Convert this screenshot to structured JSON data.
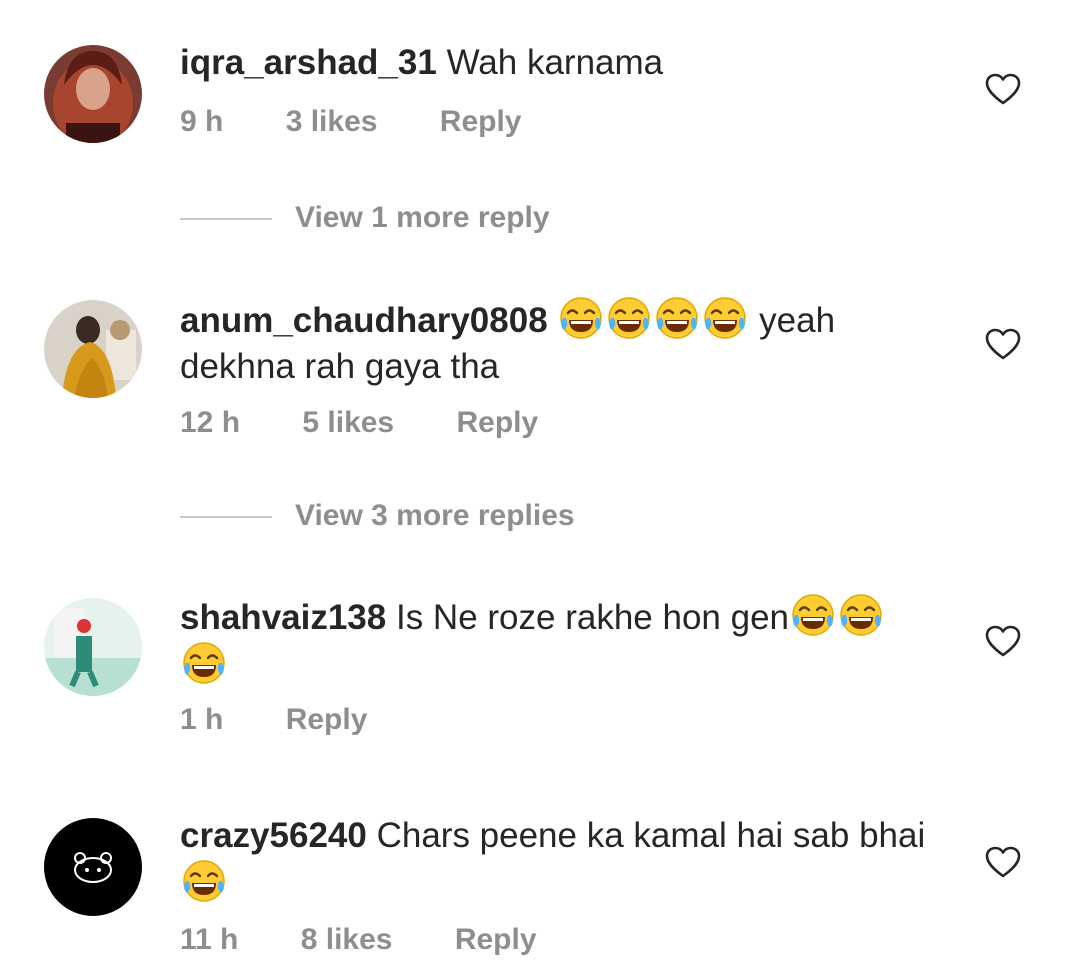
{
  "comments": [
    {
      "username": "iqra_arshad_31",
      "text_before": "Wah karnama",
      "text_after": "",
      "emoji_count": 0,
      "time": "9 h",
      "likes": "3 likes",
      "reply": "Reply",
      "view_replies": "View 1 more reply"
    },
    {
      "username": "anum_chaudhary0808",
      "text_before": "",
      "text_after": "yeah dekhna rah gaya tha",
      "emoji_count": 4,
      "time": "12 h",
      "likes": "5 likes",
      "reply": "Reply",
      "view_replies": "View 3 more replies"
    },
    {
      "username": "shahvaiz138",
      "text_before": "Is Ne roze rakhe hon gen",
      "text_after": "",
      "emoji_count": 3,
      "time": "1 h",
      "likes": "",
      "reply": "Reply",
      "view_replies": ""
    },
    {
      "username": "crazy56240",
      "text_before": "Chars peene ka kamal hai sab bhai",
      "text_after": "",
      "emoji_count": 1,
      "time": "11 h",
      "likes": "8 likes",
      "reply": "Reply",
      "view_replies": ""
    }
  ],
  "icons": {
    "like": "heart-outline-icon",
    "emoji": "face-with-tears-of-joy-emoji"
  },
  "colors": {
    "text": "#262626",
    "meta": "#8e8e8e",
    "divider": "#c7c7c7"
  }
}
